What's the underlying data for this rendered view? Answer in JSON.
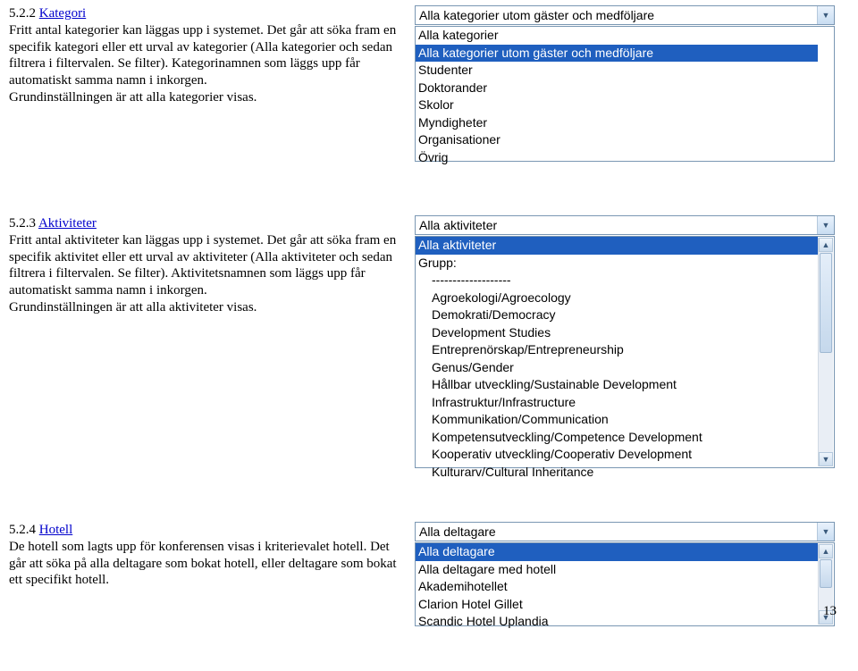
{
  "kategori": {
    "num": "5.2.2 ",
    "title": "Kategori",
    "body": "Fritt antal kategorier kan läggas upp i systemet. Det går att söka fram en specifik kategori eller ett urval av kategorier (Alla kategorier och sedan filtrera i filtervalen. Se filter). Kategorinamnen som läggs upp får automatiskt samma namn i inkorgen.\nGrundinställningen är att alla kategorier visas.",
    "dropdown_selected": "Alla kategorier utom gäster och medföljare",
    "options": [
      {
        "label": "Alla kategorier",
        "selected": false
      },
      {
        "label": "Alla kategorier utom gäster och medföljare",
        "selected": true
      },
      {
        "label": "Studenter",
        "selected": false
      },
      {
        "label": "Doktorander",
        "selected": false
      },
      {
        "label": "Skolor",
        "selected": false
      },
      {
        "label": "Myndigheter",
        "selected": false
      },
      {
        "label": "Organisationer",
        "selected": false
      },
      {
        "label": "Övrig",
        "selected": false
      }
    ]
  },
  "aktiviteter": {
    "num": "5.2.3 ",
    "title": "Aktiviteter",
    "body": "Fritt antal aktiviteter kan läggas upp i systemet. Det går att söka fram en specifik aktivitet eller ett urval av aktiviteter (Alla aktiviteter och sedan filtrera i filtervalen. Se filter). Aktivitetsnamnen som läggs upp får automatiskt samma namn i inkorgen.\nGrundinställningen är att alla aktiviteter visas.",
    "dropdown_selected": "Alla aktiviteter",
    "options": [
      {
        "label": "Alla aktiviteter",
        "selected": true,
        "indent": false
      },
      {
        "label": "Grupp:",
        "selected": false,
        "indent": false
      },
      {
        "label": "-------------------",
        "selected": false,
        "indent": true
      },
      {
        "label": "Agroekologi/Agroecology",
        "selected": false,
        "indent": true
      },
      {
        "label": "Demokrati/Democracy",
        "selected": false,
        "indent": true
      },
      {
        "label": "Development Studies",
        "selected": false,
        "indent": true
      },
      {
        "label": "Entreprenörskap/Entrepreneurship",
        "selected": false,
        "indent": true
      },
      {
        "label": "Genus/Gender",
        "selected": false,
        "indent": true
      },
      {
        "label": "Hållbar utveckling/Sustainable Development",
        "selected": false,
        "indent": true
      },
      {
        "label": "Infrastruktur/Infrastructure",
        "selected": false,
        "indent": true
      },
      {
        "label": "Kommunikation/Communication",
        "selected": false,
        "indent": true
      },
      {
        "label": "Kompetensutveckling/Competence Development",
        "selected": false,
        "indent": true
      },
      {
        "label": "Kooperativ utveckling/Cooperativ Development",
        "selected": false,
        "indent": true
      },
      {
        "label": "Kulturarv/Cultural Inheritance",
        "selected": false,
        "indent": true
      }
    ]
  },
  "hotell": {
    "num": "5.2.4 ",
    "title": "Hotell",
    "body": "De hotell som lagts upp för konferensen visas i kriterievalet hotell. Det går att söka på alla deltagare som bokat hotell, eller deltagare som bokat ett specifikt hotell.",
    "dropdown_selected": "Alla deltagare",
    "options": [
      {
        "label": "Alla deltagare",
        "selected": true
      },
      {
        "label": "Alla deltagare med hotell",
        "selected": false
      },
      {
        "label": "Akademihotellet",
        "selected": false
      },
      {
        "label": "Clarion Hotel Gillet",
        "selected": false
      },
      {
        "label": "Scandic Hotel Uplandia",
        "selected": false
      }
    ]
  },
  "page_number": "13"
}
